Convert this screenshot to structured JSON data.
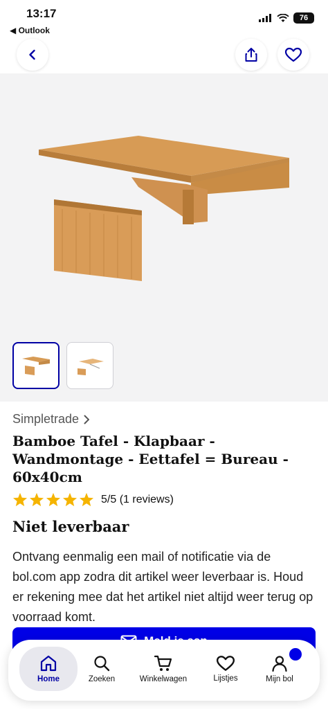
{
  "status": {
    "time": "13:17",
    "back_app": "◀ Outlook",
    "battery": "76"
  },
  "product": {
    "brand": "Simpletrade",
    "title": "Bamboe Tafel - Klapbaar - Wandmontage - Eettafel = Bureau - 60x40cm",
    "rating_stars": 5,
    "rating_text": "5/5 (1 reviews)",
    "availability": "Niet leverbaar",
    "notify_text": "Ontvang eenmalig een mail of notificatie via de bol.com app zodra dit artikel weer leverbaar is. Houd er rekening mee dat het artikel niet altijd weer terug op voorraad komt.",
    "cta_label": "Meld je aan"
  },
  "tabs": [
    {
      "label": "Home",
      "icon": "home-icon",
      "active": true
    },
    {
      "label": "Zoeken",
      "icon": "search-icon",
      "active": false
    },
    {
      "label": "Winkelwagen",
      "icon": "cart-icon",
      "active": false
    },
    {
      "label": "Lijstjes",
      "icon": "heart-icon",
      "active": false
    },
    {
      "label": "Mijn bol",
      "icon": "user-icon",
      "active": false
    }
  ],
  "colors": {
    "accent": "#0000a4",
    "cta": "#0000e6",
    "star": "#f5b400"
  }
}
